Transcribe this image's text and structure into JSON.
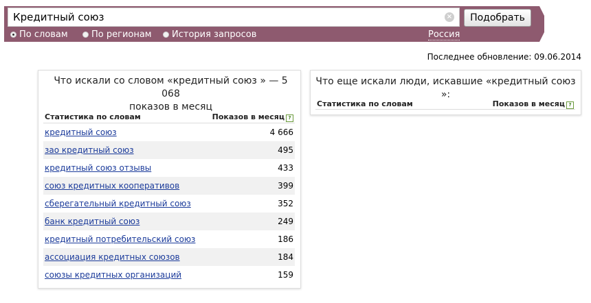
{
  "search": {
    "value": "Кредитный союз",
    "clear_glyph": "×",
    "submit_label": "Подобрать"
  },
  "modes": [
    {
      "label": "По словам",
      "selected": true
    },
    {
      "label": "По регионам",
      "selected": false
    },
    {
      "label": "История запросов",
      "selected": false
    }
  ],
  "region": "Россия",
  "last_update": "Последнее обновление: 09.06.2014",
  "left_panel": {
    "title_line1": "Что искали со словом «кредитный союз » — 5 068",
    "title_line2": "показов в месяц",
    "col_phrase": "Статистика по словам",
    "col_count": "Показов в месяц",
    "help_glyph": "?",
    "rows": [
      {
        "phrase": "кредитный союз",
        "count": "4 666"
      },
      {
        "phrase": "зао кредитный союз",
        "count": "495"
      },
      {
        "phrase": "кредитный союз отзывы",
        "count": "433"
      },
      {
        "phrase": "союз кредитных кооперативов",
        "count": "399"
      },
      {
        "phrase": "сберегательный кредитный союз",
        "count": "352"
      },
      {
        "phrase": "банк кредитный союз",
        "count": "249"
      },
      {
        "phrase": "кредитный потребительский союз",
        "count": "186"
      },
      {
        "phrase": "ассоциация кредитных союзов",
        "count": "184"
      },
      {
        "phrase": "союзы кредитных организаций",
        "count": "159"
      }
    ]
  },
  "right_panel": {
    "title": "Что еще искали люди, искавшие «кредитный союз »:",
    "col_phrase": "Статистика по словам",
    "col_count": "Показов в месяц",
    "help_glyph": "?"
  },
  "colors": {
    "bar": "#8e5a6f",
    "link": "#1a3a9a"
  }
}
